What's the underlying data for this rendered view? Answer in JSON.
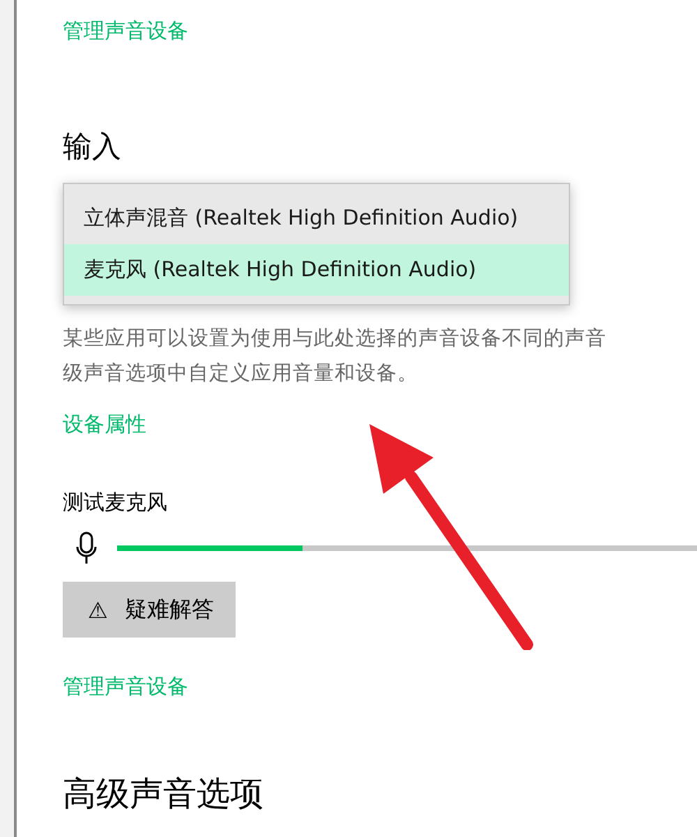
{
  "top_link": "管理声音设备",
  "input_section": {
    "heading": "输入",
    "dropdown": {
      "options": [
        {
          "label": "立体声混音 (Realtek High Definition Audio)",
          "selected": false
        },
        {
          "label": "麦克风 (Realtek High Definition Audio)",
          "selected": true
        }
      ]
    },
    "description": [
      "某些应用可以设置为使用与此处选择的声音设备不同的声音",
      "级声音选项中自定义应用音量和设备。"
    ],
    "properties_link": "设备属性",
    "test_label": "测试麦克风",
    "meter": {
      "level": 0.32
    },
    "troubleshoot_button": {
      "icon": "⚠",
      "label": "疑难解答"
    },
    "manage_link": "管理声音设备"
  },
  "advanced_heading": "高级声音选项"
}
